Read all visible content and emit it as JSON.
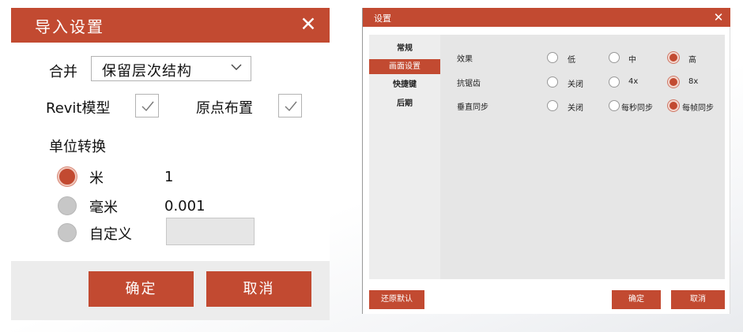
{
  "import_dialog": {
    "title": "导入设置",
    "close_glyph": "✕",
    "merge": {
      "label": "合并",
      "value": "保留层次结构"
    },
    "revit_model": {
      "label": "Revit模型",
      "checked": true
    },
    "origin_placement": {
      "label": "原点布置",
      "checked": true
    },
    "unit_conversion": {
      "heading": "单位转换",
      "options": [
        {
          "label": "米",
          "value": "1",
          "selected": true
        },
        {
          "label": "毫米",
          "value": "0.001",
          "selected": false
        },
        {
          "label": "自定义",
          "value": "",
          "selected": false
        }
      ]
    },
    "buttons": {
      "ok": "确定",
      "cancel": "取消"
    },
    "colors": {
      "accent": "#c24a31"
    }
  },
  "settings_dialog": {
    "title": "设置",
    "close_glyph": "✕",
    "nav": [
      {
        "label": "常规",
        "active": false
      },
      {
        "label": "画面设置",
        "active": true
      },
      {
        "label": "快捷键",
        "active": false
      },
      {
        "label": "后期",
        "active": false
      }
    ],
    "rows": [
      {
        "label": "效果",
        "options": [
          "低",
          "中",
          "高"
        ],
        "selected": 2
      },
      {
        "label": "抗锯齿",
        "options": [
          "关闭",
          "4x",
          "8x"
        ],
        "selected": 2
      },
      {
        "label": "垂直同步",
        "options": [
          "关闭",
          "每秒同步",
          "每帧同步"
        ],
        "selected": 2
      }
    ],
    "buttons": {
      "restore_defaults": "还原默认",
      "ok": "确定",
      "cancel": "取消"
    }
  }
}
